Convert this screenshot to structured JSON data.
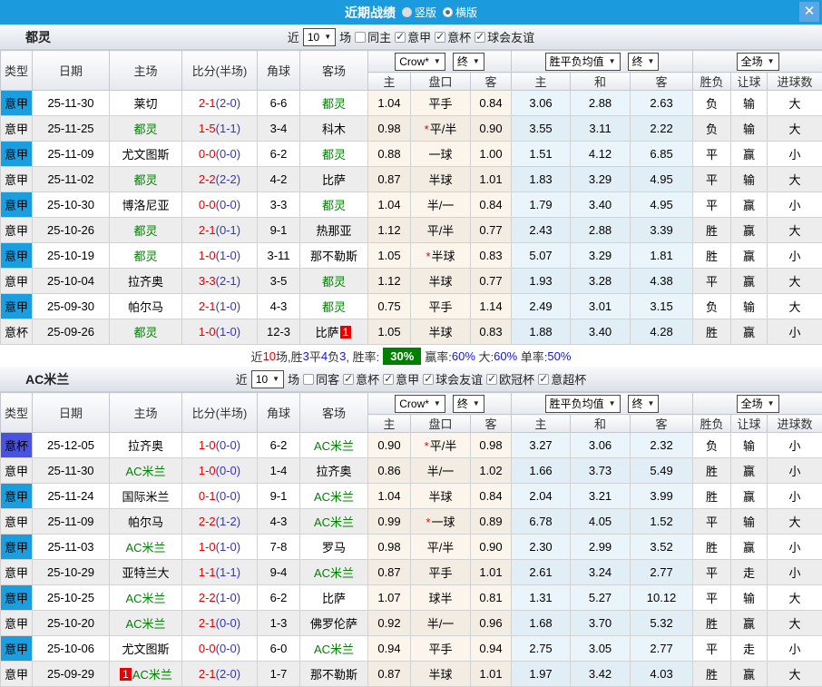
{
  "titlebar": {
    "title": "近期战绩",
    "vertical_label": "竖版",
    "horizontal_label": "横版",
    "selected_layout": "横版",
    "close_label": "✕"
  },
  "colors": {
    "titlebar_blue": "#1b9ade",
    "league_serie_a_blue": "#1b9ee0",
    "cup_indigo": "#4a52e0",
    "subject_team_green": "#008000",
    "score_red": "#e60000",
    "halftime_blue": "#3333cc",
    "win_red": "#d60000",
    "draw_blue": "#0000e8",
    "lose_green": "#008000",
    "summary_badge_green": "#008000",
    "odds_col_bg": "#fcf5ec",
    "avg_col_bg": "#eaf5fb"
  },
  "table_header": {
    "type": "类型",
    "date": "日期",
    "home": "主场",
    "score": "比分(半场)",
    "corner": "角球",
    "away": "客场",
    "odds_home": "主",
    "odds_handicap": "盘口",
    "odds_away": "客",
    "avg_home": "主",
    "avg_draw": "和",
    "avg_away": "客",
    "result": "胜负",
    "handicap_result": "让球",
    "goals": "进球数",
    "dropdown_bookmaker": "Crow*",
    "dropdown_final_1": "终",
    "dropdown_avg": "胜平负均值",
    "dropdown_final_2": "终",
    "dropdown_scope": "全场",
    "dropdown_arrow": "▼"
  },
  "sections": [
    {
      "team": "都灵",
      "filters": {
        "near_label": "近",
        "count": "10",
        "games_label": "场",
        "checkboxes": [
          {
            "label": "同主",
            "checked": false
          },
          {
            "label": "意甲",
            "checked": true
          },
          {
            "label": "意杯",
            "checked": true
          },
          {
            "label": "球会友谊",
            "checked": true
          }
        ]
      },
      "rows": [
        {
          "type": "意甲",
          "date": "25-11-30",
          "home": "莱切",
          "home_is_subject": false,
          "score_full": "2-1",
          "score_half": "(2-0)",
          "corners": "6-6",
          "away": "都灵",
          "away_is_subject": true,
          "odds_home": "1.04",
          "handicap": "平手",
          "handicap_star": false,
          "odds_away": "0.84",
          "avg_home": "3.06",
          "avg_draw": "2.88",
          "avg_away": "2.63",
          "result": "负",
          "handicap_result": "输",
          "goals": "大"
        },
        {
          "type": "意甲",
          "date": "25-11-25",
          "home": "都灵",
          "home_is_subject": true,
          "score_full": "1-5",
          "score_half": "(1-1)",
          "corners": "3-4",
          "away": "科木",
          "away_is_subject": false,
          "odds_home": "0.98",
          "handicap": "平/半",
          "handicap_star": true,
          "odds_away": "0.90",
          "avg_home": "3.55",
          "avg_draw": "3.11",
          "avg_away": "2.22",
          "result": "负",
          "handicap_result": "输",
          "goals": "大"
        },
        {
          "type": "意甲",
          "date": "25-11-09",
          "home": "尤文图斯",
          "home_is_subject": false,
          "score_full": "0-0",
          "score_half": "(0-0)",
          "corners": "6-2",
          "away": "都灵",
          "away_is_subject": true,
          "odds_home": "0.88",
          "handicap": "一球",
          "handicap_star": false,
          "odds_away": "1.00",
          "avg_home": "1.51",
          "avg_draw": "4.12",
          "avg_away": "6.85",
          "result": "平",
          "handicap_result": "赢",
          "goals": "小"
        },
        {
          "type": "意甲",
          "date": "25-11-02",
          "home": "都灵",
          "home_is_subject": true,
          "score_full": "2-2",
          "score_half": "(2-2)",
          "corners": "4-2",
          "away": "比萨",
          "away_is_subject": false,
          "odds_home": "0.87",
          "handicap": "半球",
          "handicap_star": false,
          "odds_away": "1.01",
          "avg_home": "1.83",
          "avg_draw": "3.29",
          "avg_away": "4.95",
          "result": "平",
          "handicap_result": "输",
          "goals": "大"
        },
        {
          "type": "意甲",
          "date": "25-10-30",
          "home": "博洛尼亚",
          "home_is_subject": false,
          "score_full": "0-0",
          "score_half": "(0-0)",
          "corners": "3-3",
          "away": "都灵",
          "away_is_subject": true,
          "odds_home": "1.04",
          "handicap": "半/一",
          "handicap_star": false,
          "odds_away": "0.84",
          "avg_home": "1.79",
          "avg_draw": "3.40",
          "avg_away": "4.95",
          "result": "平",
          "handicap_result": "赢",
          "goals": "小"
        },
        {
          "type": "意甲",
          "date": "25-10-26",
          "home": "都灵",
          "home_is_subject": true,
          "score_full": "2-1",
          "score_half": "(0-1)",
          "corners": "9-1",
          "away": "热那亚",
          "away_is_subject": false,
          "odds_home": "1.12",
          "handicap": "平/半",
          "handicap_star": false,
          "odds_away": "0.77",
          "avg_home": "2.43",
          "avg_draw": "2.88",
          "avg_away": "3.39",
          "result": "胜",
          "handicap_result": "赢",
          "goals": "大"
        },
        {
          "type": "意甲",
          "date": "25-10-19",
          "home": "都灵",
          "home_is_subject": true,
          "score_full": "1-0",
          "score_half": "(1-0)",
          "corners": "3-11",
          "away": "那不勒斯",
          "away_is_subject": false,
          "odds_home": "1.05",
          "handicap": "半球",
          "handicap_star": true,
          "odds_away": "0.83",
          "avg_home": "5.07",
          "avg_draw": "3.29",
          "avg_away": "1.81",
          "result": "胜",
          "handicap_result": "赢",
          "goals": "小"
        },
        {
          "type": "意甲",
          "date": "25-10-04",
          "home": "拉齐奥",
          "home_is_subject": false,
          "score_full": "3-3",
          "score_half": "(2-1)",
          "corners": "3-5",
          "away": "都灵",
          "away_is_subject": true,
          "odds_home": "1.12",
          "handicap": "半球",
          "handicap_star": false,
          "odds_away": "0.77",
          "avg_home": "1.93",
          "avg_draw": "3.28",
          "avg_away": "4.38",
          "result": "平",
          "handicap_result": "赢",
          "goals": "大"
        },
        {
          "type": "意甲",
          "date": "25-09-30",
          "home": "帕尔马",
          "home_is_subject": false,
          "score_full": "2-1",
          "score_half": "(1-0)",
          "corners": "4-3",
          "away": "都灵",
          "away_is_subject": true,
          "odds_home": "0.75",
          "handicap": "平手",
          "handicap_star": false,
          "odds_away": "1.14",
          "avg_home": "2.49",
          "avg_draw": "3.01",
          "avg_away": "3.15",
          "result": "负",
          "handicap_result": "输",
          "goals": "大"
        },
        {
          "type": "意杯",
          "date": "25-09-26",
          "home": "都灵",
          "home_is_subject": true,
          "score_full": "1-0",
          "score_half": "(1-0)",
          "corners": "12-3",
          "away": "比萨",
          "away_is_subject": false,
          "away_badge": "1",
          "odds_home": "1.05",
          "handicap": "半球",
          "handicap_star": false,
          "odds_away": "0.83",
          "avg_home": "1.88",
          "avg_draw": "3.40",
          "avg_away": "4.28",
          "result": "胜",
          "handicap_result": "赢",
          "goals": "小"
        }
      ],
      "summary": {
        "parts": [
          {
            "text": "近",
            "style": "k"
          },
          {
            "text": "10",
            "style": "r"
          },
          {
            "text": "场,胜",
            "style": "k"
          },
          {
            "text": "3",
            "style": "b"
          },
          {
            "text": "平",
            "style": "k"
          },
          {
            "text": "4",
            "style": "b"
          },
          {
            "text": "负",
            "style": "k"
          },
          {
            "text": "3",
            "style": "b"
          },
          {
            "text": ", 胜率:",
            "style": "k"
          },
          {
            "text": "30%",
            "style": "badge"
          },
          {
            "text": "赢率:",
            "style": "k"
          },
          {
            "text": "60%",
            "style": "b"
          },
          {
            "text": " 大:",
            "style": "k"
          },
          {
            "text": "60%",
            "style": "b"
          },
          {
            "text": " 单率:",
            "style": "k"
          },
          {
            "text": "50%",
            "style": "b"
          }
        ]
      }
    },
    {
      "team": "AC米兰",
      "filters": {
        "near_label": "近",
        "count": "10",
        "games_label": "场",
        "checkboxes": [
          {
            "label": "同客",
            "checked": false
          },
          {
            "label": "意杯",
            "checked": true
          },
          {
            "label": "意甲",
            "checked": true
          },
          {
            "label": "球会友谊",
            "checked": true
          },
          {
            "label": "欧冠杯",
            "checked": true
          },
          {
            "label": "意超杯",
            "checked": true
          }
        ]
      },
      "rows": [
        {
          "type": "意杯",
          "date": "25-12-05",
          "home": "拉齐奥",
          "home_is_subject": false,
          "score_full": "1-0",
          "score_half": "(0-0)",
          "corners": "6-2",
          "away": "AC米兰",
          "away_is_subject": true,
          "odds_home": "0.90",
          "handicap": "平/半",
          "handicap_star": true,
          "odds_away": "0.98",
          "avg_home": "3.27",
          "avg_draw": "3.06",
          "avg_away": "2.32",
          "result": "负",
          "handicap_result": "输",
          "goals": "小"
        },
        {
          "type": "意甲",
          "date": "25-11-30",
          "home": "AC米兰",
          "home_is_subject": true,
          "score_full": "1-0",
          "score_half": "(0-0)",
          "corners": "1-4",
          "away": "拉齐奥",
          "away_is_subject": false,
          "odds_home": "0.86",
          "handicap": "半/一",
          "handicap_star": false,
          "odds_away": "1.02",
          "avg_home": "1.66",
          "avg_draw": "3.73",
          "avg_away": "5.49",
          "result": "胜",
          "handicap_result": "赢",
          "goals": "小"
        },
        {
          "type": "意甲",
          "date": "25-11-24",
          "home": "国际米兰",
          "home_is_subject": false,
          "score_full": "0-1",
          "score_half": "(0-0)",
          "corners": "9-1",
          "away": "AC米兰",
          "away_is_subject": true,
          "odds_home": "1.04",
          "handicap": "半球",
          "handicap_star": false,
          "odds_away": "0.84",
          "avg_home": "2.04",
          "avg_draw": "3.21",
          "avg_away": "3.99",
          "result": "胜",
          "handicap_result": "赢",
          "goals": "小"
        },
        {
          "type": "意甲",
          "date": "25-11-09",
          "home": "帕尔马",
          "home_is_subject": false,
          "score_full": "2-2",
          "score_half": "(1-2)",
          "corners": "4-3",
          "away": "AC米兰",
          "away_is_subject": true,
          "odds_home": "0.99",
          "handicap": "一球",
          "handicap_star": true,
          "odds_away": "0.89",
          "avg_home": "6.78",
          "avg_draw": "4.05",
          "avg_away": "1.52",
          "result": "平",
          "handicap_result": "输",
          "goals": "大"
        },
        {
          "type": "意甲",
          "date": "25-11-03",
          "home": "AC米兰",
          "home_is_subject": true,
          "score_full": "1-0",
          "score_half": "(1-0)",
          "corners": "7-8",
          "away": "罗马",
          "away_is_subject": false,
          "odds_home": "0.98",
          "handicap": "平/半",
          "handicap_star": false,
          "odds_away": "0.90",
          "avg_home": "2.30",
          "avg_draw": "2.99",
          "avg_away": "3.52",
          "result": "胜",
          "handicap_result": "赢",
          "goals": "小"
        },
        {
          "type": "意甲",
          "date": "25-10-29",
          "home": "亚特兰大",
          "home_is_subject": false,
          "score_full": "1-1",
          "score_half": "(1-1)",
          "corners": "9-4",
          "away": "AC米兰",
          "away_is_subject": true,
          "odds_home": "0.87",
          "handicap": "平手",
          "handicap_star": false,
          "odds_away": "1.01",
          "avg_home": "2.61",
          "avg_draw": "3.24",
          "avg_away": "2.77",
          "result": "平",
          "handicap_result": "走",
          "goals": "小"
        },
        {
          "type": "意甲",
          "date": "25-10-25",
          "home": "AC米兰",
          "home_is_subject": true,
          "score_full": "2-2",
          "score_half": "(1-0)",
          "corners": "6-2",
          "away": "比萨",
          "away_is_subject": false,
          "odds_home": "1.07",
          "handicap": "球半",
          "handicap_star": false,
          "odds_away": "0.81",
          "avg_home": "1.31",
          "avg_draw": "5.27",
          "avg_away": "10.12",
          "result": "平",
          "handicap_result": "输",
          "goals": "大"
        },
        {
          "type": "意甲",
          "date": "25-10-20",
          "home": "AC米兰",
          "home_is_subject": true,
          "score_full": "2-1",
          "score_half": "(0-0)",
          "corners": "1-3",
          "away": "佛罗伦萨",
          "away_is_subject": false,
          "odds_home": "0.92",
          "handicap": "半/一",
          "handicap_star": false,
          "odds_away": "0.96",
          "avg_home": "1.68",
          "avg_draw": "3.70",
          "avg_away": "5.32",
          "result": "胜",
          "handicap_result": "赢",
          "goals": "大"
        },
        {
          "type": "意甲",
          "date": "25-10-06",
          "home": "尤文图斯",
          "home_is_subject": false,
          "score_full": "0-0",
          "score_half": "(0-0)",
          "corners": "6-0",
          "away": "AC米兰",
          "away_is_subject": true,
          "odds_home": "0.94",
          "handicap": "平手",
          "handicap_star": false,
          "odds_away": "0.94",
          "avg_home": "2.75",
          "avg_draw": "3.05",
          "avg_away": "2.77",
          "result": "平",
          "handicap_result": "走",
          "goals": "小"
        },
        {
          "type": "意甲",
          "date": "25-09-29",
          "home": "AC米兰",
          "home_is_subject": true,
          "home_badge": "1",
          "score_full": "2-1",
          "score_half": "(2-0)",
          "corners": "1-7",
          "away": "那不勒斯",
          "away_is_subject": false,
          "odds_home": "0.87",
          "handicap": "半球",
          "handicap_star": false,
          "odds_away": "1.01",
          "avg_home": "1.97",
          "avg_draw": "3.42",
          "avg_away": "4.03",
          "result": "胜",
          "handicap_result": "赢",
          "goals": "大"
        }
      ]
    }
  ]
}
